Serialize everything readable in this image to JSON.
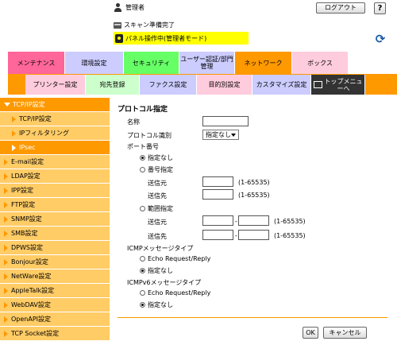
{
  "header": {
    "user_label": "管理者",
    "logout_label": "ログアウト",
    "help_label": "?",
    "status_scan": "スキャン準備完了",
    "status_panel": "パネル操作中(管理者モード)",
    "refresh_icon": "⟳"
  },
  "tabs_top": [
    {
      "label": "メンテナンス",
      "color": "#ff6699"
    },
    {
      "label": "環境設定",
      "color": "#ccccff"
    },
    {
      "label": "セキュリティ",
      "color": "#66ff66"
    },
    {
      "label": "ユーザー認証/部門管理",
      "color": "#ccccff"
    },
    {
      "label": "ネットワーク",
      "color": "#ff9900"
    },
    {
      "label": "ボックス",
      "color": "#ffccdd"
    }
  ],
  "tabs_sub": [
    {
      "label": "プリンター設定",
      "color": "#ffccdd"
    },
    {
      "label": "宛先登録",
      "color": "#ccffcc"
    },
    {
      "label": "ファクス設定",
      "color": "#ccccff"
    },
    {
      "label": "目的別設定",
      "color": "#ffccdd"
    },
    {
      "label": "カスタマイズ設定",
      "color": "#ccccff"
    },
    {
      "label": "トップメニューへ",
      "color": "#333333"
    }
  ],
  "sidebar": {
    "items": [
      {
        "label": "TCP/IP設定",
        "state": "open"
      },
      {
        "label": "TCP/IP設定",
        "state": "sub"
      },
      {
        "label": "IPフィルタリング",
        "state": "sub"
      },
      {
        "label": "IPsec",
        "state": "active"
      },
      {
        "label": "E-mail設定",
        "state": "closed"
      },
      {
        "label": "LDAP設定",
        "state": "closed"
      },
      {
        "label": "IPP設定",
        "state": "closed"
      },
      {
        "label": "FTP設定",
        "state": "closed"
      },
      {
        "label": "SNMP設定",
        "state": "closed"
      },
      {
        "label": "SMB設定",
        "state": "closed"
      },
      {
        "label": "DPWS設定",
        "state": "closed"
      },
      {
        "label": "Bonjour設定",
        "state": "closed"
      },
      {
        "label": "NetWare設定",
        "state": "closed"
      },
      {
        "label": "AppleTalk設定",
        "state": "closed"
      },
      {
        "label": "WebDAV設定",
        "state": "closed"
      },
      {
        "label": "OpenAPI設定",
        "state": "closed"
      },
      {
        "label": "TCP Socket設定",
        "state": "closed"
      }
    ]
  },
  "main": {
    "title": "プロトコル指定",
    "name_label": "名称",
    "name_value": "",
    "protocol_label": "プロトコル識別",
    "protocol_value": "指定なし",
    "port_label": "ポート番号",
    "port_none": "指定なし",
    "port_number": "番号指定",
    "src_label": "送信元",
    "dst_label": "送信先",
    "src_value": "",
    "dst_value": "",
    "range_hint": "(1-65535)",
    "port_range": "範囲指定",
    "range_sep": "-",
    "range_src_from": "",
    "range_src_to": "",
    "range_dst_from": "",
    "range_dst_to": "",
    "icmp_label": "ICMPメッセージタイプ",
    "icmp_echo": "Echo Request/Reply",
    "icmp_none": "指定なし",
    "icmpv6_label": "ICMPv6メッセージタイプ",
    "icmpv6_echo": "Echo Request/Reply",
    "icmpv6_none": "指定なし",
    "ok_label": "OK",
    "cancel_label": "キャンセル"
  }
}
